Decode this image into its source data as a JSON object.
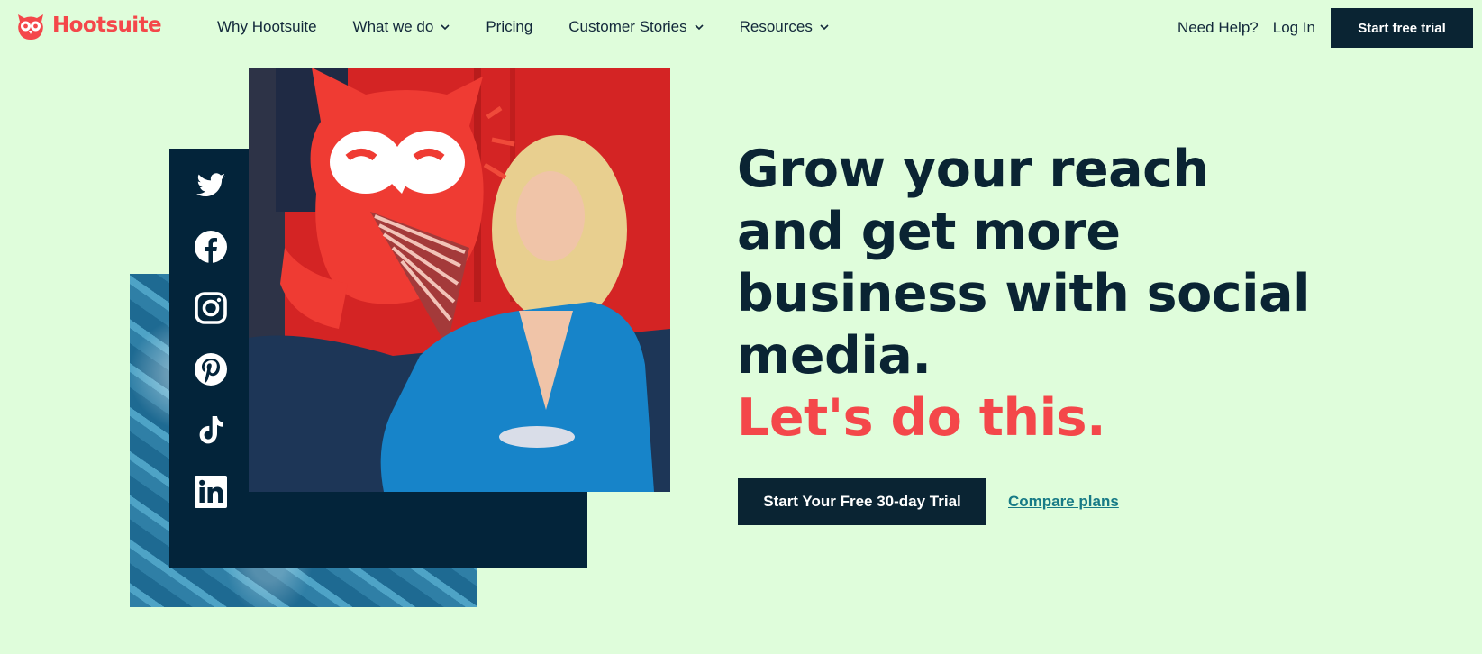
{
  "brand": {
    "name": "Hootsuite",
    "accent_color": "#f4474a",
    "navy_color": "#0a2433",
    "background_color": "#dffddb"
  },
  "nav": {
    "items": [
      {
        "label": "Why Hootsuite",
        "has_dropdown": false
      },
      {
        "label": "What we do",
        "has_dropdown": true
      },
      {
        "label": "Pricing",
        "has_dropdown": false
      },
      {
        "label": "Customer Stories",
        "has_dropdown": true
      },
      {
        "label": "Resources",
        "has_dropdown": true
      }
    ],
    "help_label": "Need Help?",
    "login_label": "Log In",
    "cta_label": "Start free trial"
  },
  "collage": {
    "social_icons": [
      "twitter-icon",
      "facebook-icon",
      "instagram-icon",
      "pinterest-icon",
      "tiktok-icon",
      "linkedin-icon"
    ]
  },
  "hero": {
    "headline": "Grow your reach and get more business with social media.",
    "headline_lines": [
      "Grow your reach",
      "and get more",
      "business with social",
      "media."
    ],
    "headline_accent": "Let's do this.",
    "cta_primary_label": "Start Your Free 30-day Trial",
    "cta_secondary_label": "Compare plans"
  }
}
